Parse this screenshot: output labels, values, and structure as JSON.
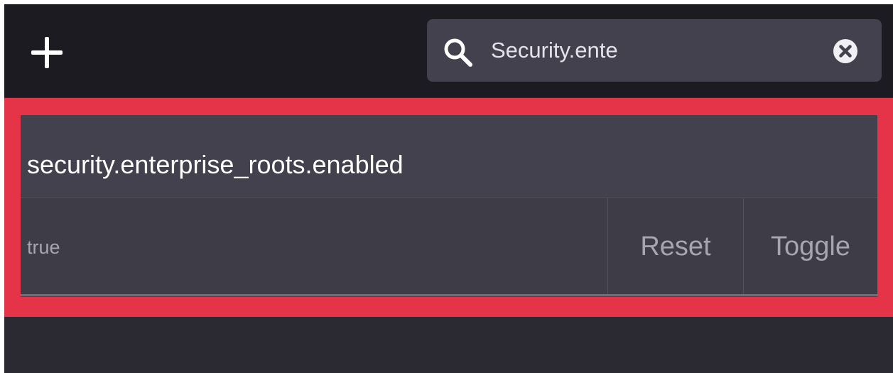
{
  "toolbar": {
    "add_icon": "plus-icon",
    "search": {
      "value": "Security.ente",
      "icon": "search-icon",
      "clear_icon": "clear-circle-x-icon"
    }
  },
  "preference": {
    "name": "security.enterprise_roots.enabled",
    "value": "true",
    "reset_label": "Reset",
    "toggle_label": "Toggle"
  },
  "colors": {
    "toolbar_bg": "#1c1b22",
    "page_bg": "#2b2a33",
    "card_bg": "#42414d",
    "highlight": "#e53347",
    "text_primary": "#ffffff",
    "text_secondary": "#a7a6b0"
  }
}
